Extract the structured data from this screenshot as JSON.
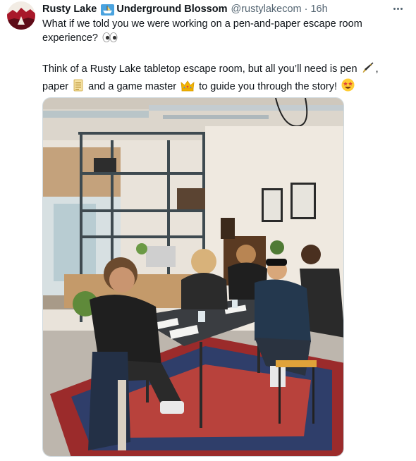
{
  "author": {
    "name": "Rusty Lake",
    "name_suffix": "Underground Blossom",
    "handle": "@rustylakecom",
    "separator": "·",
    "time": "16h",
    "avatar_icon": "rusty-lake-logo"
  },
  "tweet": {
    "line1": "What if we told you we were working on a pen-and-paper escape room",
    "line2": "experience?",
    "line3a": "Think of a Rusty Lake tabletop escape room, but all you’ll need is pen",
    "line3b": ",",
    "line4a": "paper",
    "line4b": "and a game master",
    "line4c": "to guide you through the story!"
  },
  "emojis": [
    "eyes",
    "fountain-pen",
    "page-facing-up",
    "crown",
    "star-struck"
  ],
  "colors": {
    "text": "#0f1419",
    "secondary": "#536471",
    "border": "#cfd9de"
  }
}
